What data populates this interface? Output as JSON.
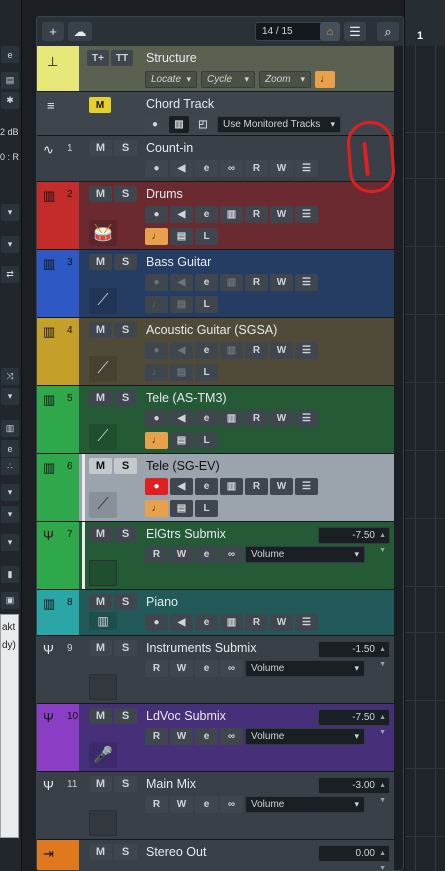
{
  "toolbar": {
    "add_icon": "plus-icon",
    "cloud_icon": "cloud-icon",
    "track_count": "14 / 15",
    "home_icon": "home-icon",
    "list_icon": "list-icon",
    "search_icon": "search-icon"
  },
  "left_panel": {
    "db_value": "2 dB",
    "route_value": "0 : R",
    "note_line1": "akt",
    "note_line2": "dy)"
  },
  "ruler": {
    "bar": "1"
  },
  "structure": {
    "name": "Structure",
    "locate": "Locate",
    "cycle": "Cycle",
    "zoom": "Zoom"
  },
  "chord": {
    "name": "Chord Track",
    "badge": "M",
    "monitor": "Use Monitored Tracks"
  },
  "labels": {
    "mute": "M",
    "solo": "S",
    "read": "R",
    "write": "W",
    "lock": "L"
  },
  "tracks": [
    {
      "num": "1",
      "name": "Count-in",
      "color": "#3b434a"
    },
    {
      "num": "2",
      "name": "Drums",
      "color": "#c42b2b"
    },
    {
      "num": "3",
      "name": "Bass Guitar",
      "color": "#2e58c4"
    },
    {
      "num": "4",
      "name": "Acoustic Guitar (SGSA)",
      "color": "#c4a02a"
    },
    {
      "num": "5",
      "name": "Tele (AS-TM3)",
      "color": "#2ea84a"
    },
    {
      "num": "6",
      "name": "Tele (SG-EV)",
      "color": "#2ea84a"
    },
    {
      "num": "7",
      "name": "ElGtrs Submix",
      "color": "#2ea84a",
      "value": "-7.50",
      "param": "Volume"
    },
    {
      "num": "8",
      "name": "Piano",
      "color": "#2aa6a6"
    },
    {
      "num": "9",
      "name": "Instruments Submix",
      "color": "#3b434a",
      "value": "-1.50",
      "param": "Volume"
    },
    {
      "num": "10",
      "name": "LdVoc Submix",
      "color": "#8a3ec4",
      "value": "-7.50",
      "param": "Volume"
    },
    {
      "num": "11",
      "name": "Main Mix",
      "color": "#3b434a",
      "value": "-3.00",
      "param": "Volume"
    },
    {
      "num": "",
      "name": "Stereo Out",
      "color": "#e0781e",
      "value": "0.00"
    }
  ],
  "colors": {
    "count_bg": "#3a4047",
    "drums_bg": "#6a2a2f",
    "bass_bg": "#263d63",
    "acoustic_bg": "#504b38",
    "tele1_bg": "#245a36",
    "tele2_bg": "#9ba3ac",
    "elgtrs_bg": "#245a36",
    "piano_bg": "#225a5a",
    "instr_bg": "#3a4047",
    "ldvoc_bg": "#46307a",
    "main_bg": "#3a4047",
    "out_bg": "#3a4047",
    "structure_bg": "#5b6150",
    "accent_orange": "#e7a14a",
    "annotation_red": "#e02020"
  }
}
